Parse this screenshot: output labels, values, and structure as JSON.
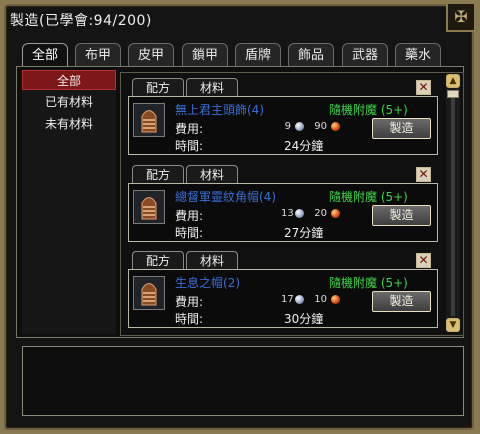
{
  "window": {
    "title": "製造(已學會:94/200)",
    "corner_icon": "ornament-knot-icon"
  },
  "tabs": [
    {
      "label": "全部",
      "active": true
    },
    {
      "label": "布甲"
    },
    {
      "label": "皮甲"
    },
    {
      "label": "鎖甲"
    },
    {
      "label": "盾牌"
    },
    {
      "label": "飾品"
    },
    {
      "label": "武器"
    },
    {
      "label": "藥水"
    }
  ],
  "filters": [
    {
      "label": "全部",
      "selected": true
    },
    {
      "label": "已有材料"
    },
    {
      "label": "未有材料"
    }
  ],
  "recipe_tab_label": "配方",
  "material_tab_label": "材料",
  "fee_label": "費用:",
  "time_label": "時間:",
  "make_button_label": "製造",
  "recipes": [
    {
      "name": "無上君主頭飾(4)",
      "bonus": "隨機附魔 (5+)",
      "cost_silver": "9",
      "cost_gold": "90",
      "time": "24分鐘"
    },
    {
      "name": "總督軍靈紋角帽(4)",
      "bonus": "隨機附魔 (5+)",
      "cost_silver": "13",
      "cost_gold": "20",
      "time": "27分鐘"
    },
    {
      "name": "生息之帽(2)",
      "bonus": "隨機附魔 (5+)",
      "cost_silver": "17",
      "cost_gold": "10",
      "time": "30分鐘"
    }
  ],
  "colors": {
    "item_name": "#3a6ed8",
    "bonus": "#3cd24a",
    "selected_filter": "#7e1818"
  },
  "icons": {
    "item": "helmet-icon",
    "silver": "silver-coin-icon",
    "gold": "gold-coin-icon",
    "close": "close-icon",
    "scroll_up": "arrow-up-icon",
    "scroll_down": "arrow-down-icon"
  },
  "info_panel": {
    "text": ""
  }
}
